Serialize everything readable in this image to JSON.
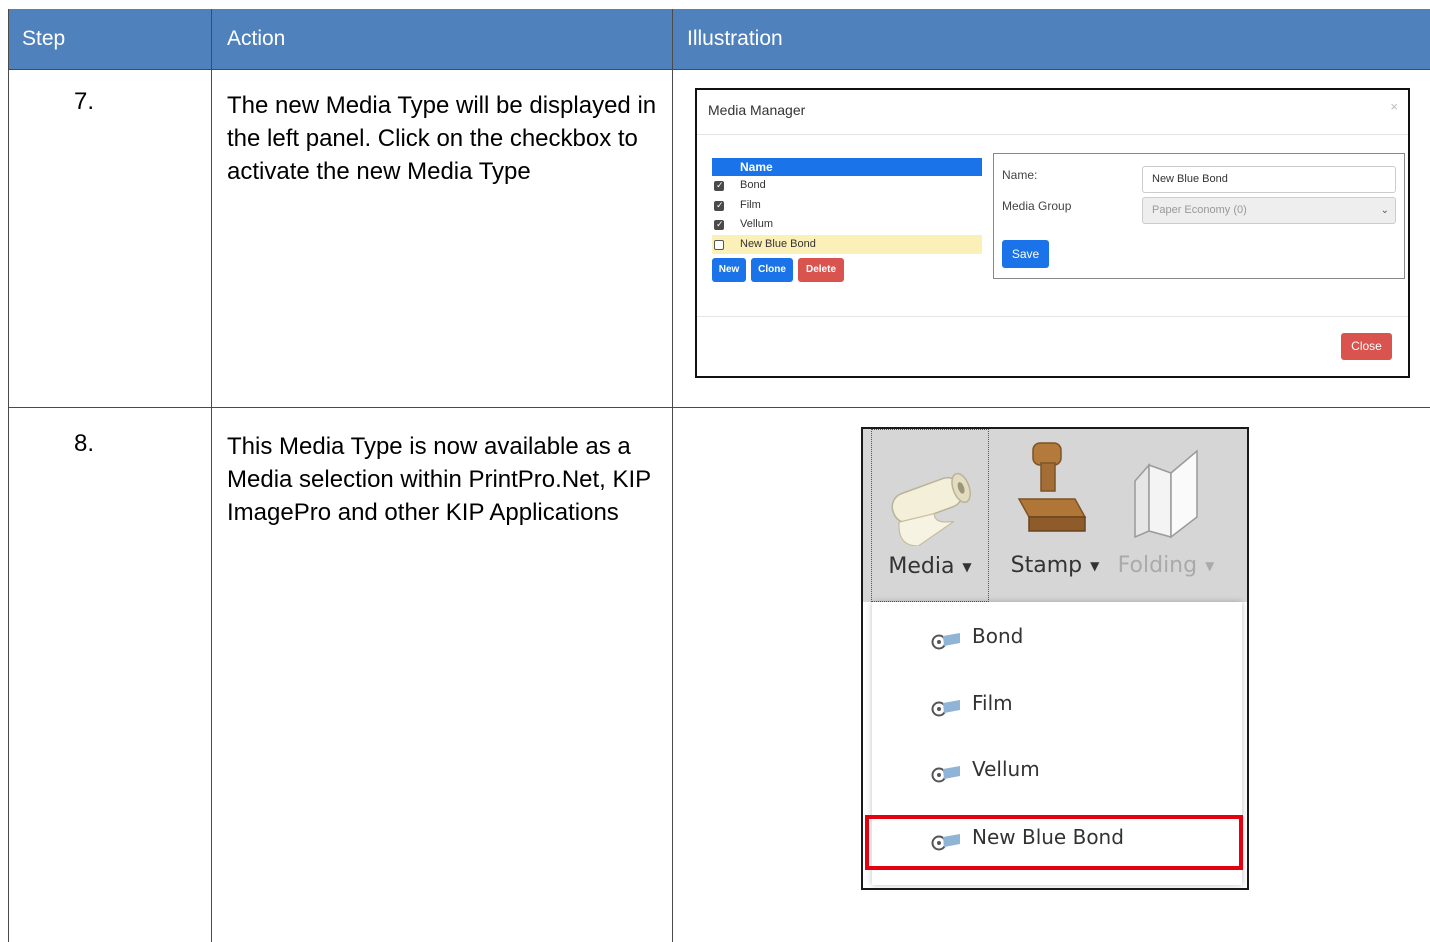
{
  "table": {
    "headers": {
      "step": "Step",
      "action": "Action",
      "illustration": "Illustration"
    },
    "rows": [
      {
        "step": "7.",
        "action": "The new Media Type will be displayed in the left panel. Click on the checkbox to activate the new Media Type"
      },
      {
        "step": "8.",
        "action": "This Media Type is now available as a Media selection within PrintPro.Net, KIP ImagePro and other KIP Applications"
      }
    ]
  },
  "media_manager": {
    "title": "Media Manager",
    "close_x": "×",
    "list_header": "Name",
    "items": [
      {
        "label": "Bond",
        "checked": true
      },
      {
        "label": "Film",
        "checked": true
      },
      {
        "label": "Vellum",
        "checked": true
      },
      {
        "label": "New Blue Bond",
        "checked": false,
        "highlighted": true
      }
    ],
    "buttons": {
      "new": "New",
      "clone": "Clone",
      "delete": "Delete"
    },
    "form": {
      "name_label": "Name:",
      "name_value": "New Blue Bond",
      "group_label": "Media Group",
      "group_value": "Paper Economy (0)",
      "save": "Save"
    },
    "close": "Close"
  },
  "media_dropdown": {
    "ribbon": {
      "media": "Media",
      "stamp": "Stamp",
      "folding": "Folding"
    },
    "items": [
      "Bond",
      "Film",
      "Vellum",
      "New Blue Bond"
    ],
    "highlighted_item": "New Blue Bond",
    "highlight_color": "#e3000f"
  },
  "colors": {
    "header_bg": "#4f81bd",
    "primary_btn": "#1a73e8",
    "danger_btn": "#d9534f"
  }
}
